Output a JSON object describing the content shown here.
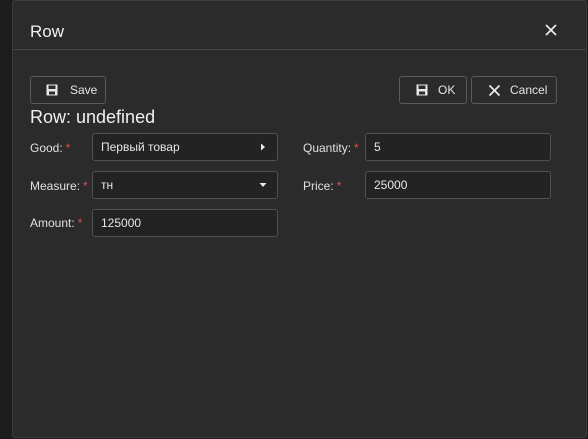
{
  "dialog": {
    "title": "Row",
    "heading": "Row: undefined"
  },
  "toolbar": {
    "save_label": "Save",
    "ok_label": "OK",
    "cancel_label": "Cancel"
  },
  "form": {
    "good": {
      "label": "Good:",
      "value": "Первый товар"
    },
    "measure": {
      "label": "Measure:",
      "value": "тн"
    },
    "amount": {
      "label": "Amount:",
      "value": "125000"
    },
    "quantity": {
      "label": "Quantity:",
      "value": "5"
    },
    "price": {
      "label": "Price:",
      "value": "25000"
    },
    "required_mark": "*"
  },
  "icons": {
    "save": "floppy-disk-icon",
    "ok": "floppy-disk-icon",
    "cancel": "x-icon",
    "close": "close-icon",
    "good_picker": "caret-right-icon",
    "measure_dropdown": "caret-down-icon"
  },
  "colors": {
    "dialog_bg": "#2b2b2b",
    "input_bg": "#232323",
    "border": "#505050",
    "required": "#e0504e",
    "text": "#e6e6e6"
  }
}
